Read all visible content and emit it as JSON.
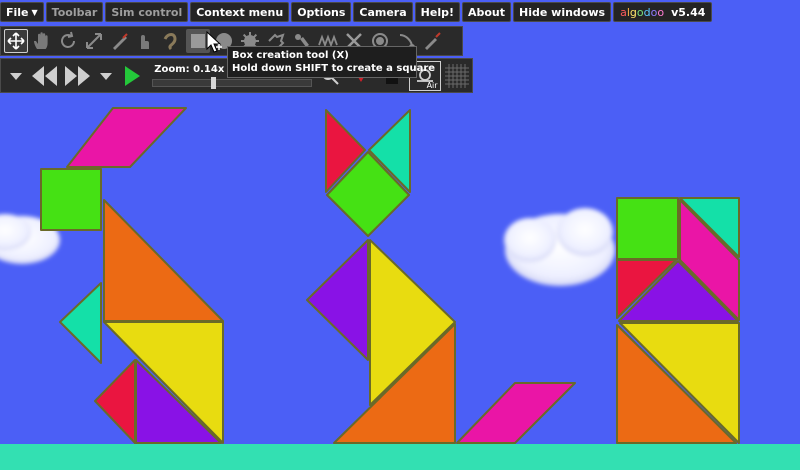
{
  "menu": {
    "items": [
      {
        "label": "File",
        "has_dropdown": true,
        "dimmed": false
      },
      {
        "label": "Toolbar",
        "has_dropdown": false,
        "dimmed": true
      },
      {
        "label": "Sim control",
        "has_dropdown": false,
        "dimmed": true
      },
      {
        "label": "Context menu",
        "has_dropdown": false,
        "dimmed": false
      },
      {
        "label": "Options",
        "has_dropdown": false,
        "dimmed": false
      },
      {
        "label": "Camera",
        "has_dropdown": false,
        "dimmed": false
      },
      {
        "label": "Help!",
        "has_dropdown": false,
        "dimmed": false
      },
      {
        "label": "About",
        "has_dropdown": false,
        "dimmed": false
      },
      {
        "label": "Hide windows",
        "has_dropdown": false,
        "dimmed": false
      }
    ],
    "brand": "algodoo",
    "brand_colors": [
      "#ff5b5b",
      "#ffb347",
      "#ffe66b",
      "#7be07b",
      "#5bc8ff",
      "#8f7bff",
      "#ff7bd1"
    ],
    "version": "v5.44"
  },
  "toolbar": {
    "tools": [
      "move-tool-icon",
      "drag-hand-tool-icon",
      "rotate-tool-icon",
      "scale-tool-icon",
      "knife-tool-icon",
      "sketch-tool-icon",
      "brush-tool-icon",
      "box-tool-icon",
      "circle-tool-icon",
      "gear-tool-icon",
      "plane-tool-icon",
      "chain-tool-icon",
      "spring-tool-icon",
      "fixate-tool-icon",
      "hinge-tool-icon",
      "tracer-tool-icon",
      "laser-tool-icon"
    ],
    "active_tool": "move-tool-icon",
    "hover_tool": "box-tool-icon"
  },
  "tooltip": {
    "title": "Box creation tool (X)",
    "hint": "Hold down SHIFT to create a square"
  },
  "simcontrol": {
    "zoom_label": "Zoom: 0.14x",
    "zoom_level": 0.37,
    "air_label": "Air",
    "play_color": "#24c83a"
  },
  "scene": {
    "sky_color": "#4b5ff6",
    "ground_color": "#33e0b2",
    "colors": {
      "magenta": "#ea15a6",
      "green": "#45e114",
      "orange": "#ec6a14",
      "yellow": "#e8dc10",
      "teal": "#14e0a8",
      "red": "#ea1540",
      "purple": "#8912e6"
    }
  }
}
